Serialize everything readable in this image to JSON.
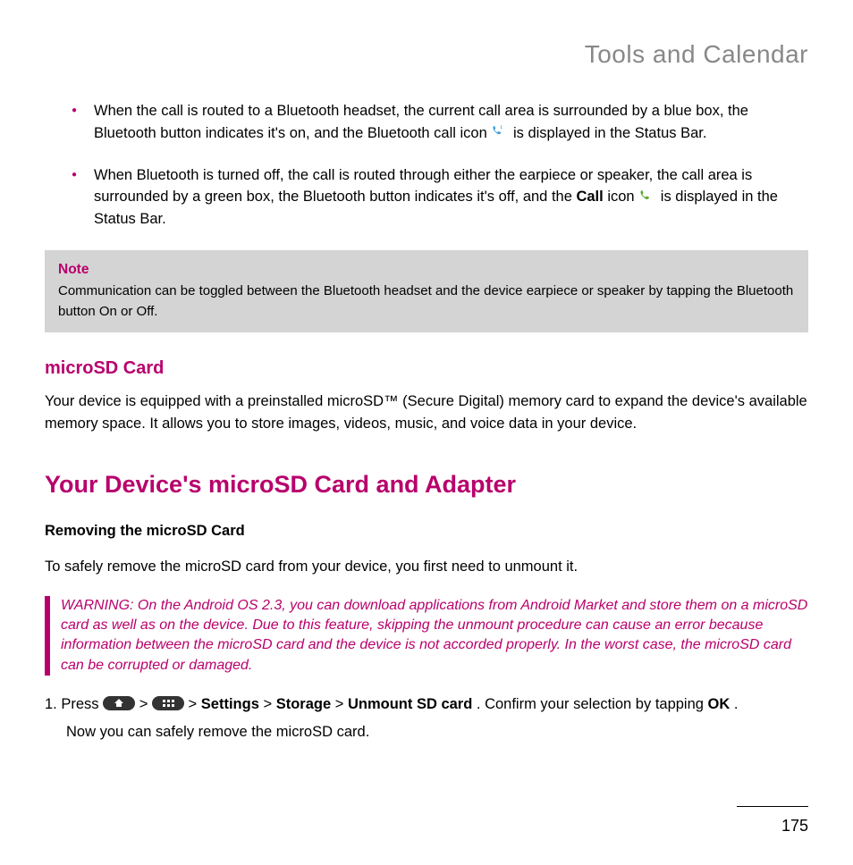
{
  "header": {
    "title": "Tools and Calendar"
  },
  "bullets": [
    {
      "pre": "When the call is routed to a Bluetooth headset, the current call area is surrounded by a blue box, the Bluetooth button indicates it's on, and the Bluetooth call icon ",
      "post": " is displayed in the Status Bar."
    },
    {
      "pre": "When Bluetooth is turned off, the call is routed through either the earpiece or speaker, the call area is surrounded by a green box, the Bluetooth button indicates it's off, and the ",
      "bold": "Call",
      "mid": " icon ",
      "post": " is displayed in the Status Bar."
    }
  ],
  "note": {
    "title": "Note",
    "body": "Communication can be toggled between the Bluetooth headset and the device earpiece or speaker by tapping the Bluetooth button On or Off."
  },
  "section1": {
    "heading": "microSD Card",
    "body": "Your device is equipped with a preinstalled microSD™ (Secure Digital) memory card to expand the device's available memory space. It allows you to store images, videos, music, and voice data in your device."
  },
  "section2": {
    "heading": "Your Device's microSD Card and Adapter",
    "subheading": "Removing the microSD Card",
    "body": "To safely remove the microSD card from your device, you first need to unmount it."
  },
  "warning": {
    "text": "WARNING: On the Android OS 2.3, you can download applications from Android Market and store them on a microSD card as well as on the device. Due to this feature, skipping the unmount procedure can cause an error because information between the microSD card and the device is not accorded properly. In the worst case, the microSD card can be corrupted or damaged."
  },
  "step": {
    "num": "1.",
    "press": "Press ",
    "sep": "  >  ",
    "settings": "Settings",
    "storage": "Storage",
    "unmount": "Unmount SD card",
    "confirm": ". Confirm your selection by tapping ",
    "ok": "OK",
    "period": ".",
    "line2": "Now you can safely remove the microSD card."
  },
  "page": "175"
}
